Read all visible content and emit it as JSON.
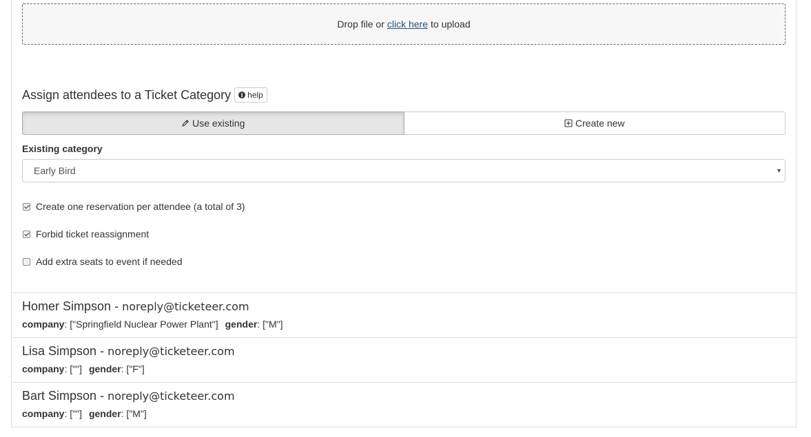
{
  "upload": {
    "prefix": "Drop file or",
    "link": "click here",
    "suffix": "to upload"
  },
  "assign": {
    "title": "Assign attendees to a Ticket Category",
    "help_label": "help",
    "use_existing_label": "Use existing",
    "create_new_label": "Create new",
    "active_tab": "Use existing"
  },
  "category": {
    "label": "Existing category",
    "selected": "Early Bird"
  },
  "options": [
    {
      "label": "Create one reservation per attendee (a total of 3)",
      "checked": true
    },
    {
      "label": "Forbid ticket reassignment",
      "checked": true
    },
    {
      "label": "Add extra seats to event if needed",
      "checked": false
    }
  ],
  "attendees": [
    {
      "name": "Homer Simpson",
      "sep": "-",
      "email": "noreply@ticketeer.com",
      "company_key": "company",
      "company_val": ": [\"Springfield Nuclear Power Plant\"]",
      "gender_key": "gender",
      "gender_val": ": [\"M\"]"
    },
    {
      "name": "Lisa Simpson",
      "sep": "-",
      "email": "noreply@ticketeer.com",
      "company_key": "company",
      "company_val": ": [\"\"]",
      "gender_key": "gender",
      "gender_val": ": [\"F\"]"
    },
    {
      "name": "Bart Simpson",
      "sep": "-",
      "email": "noreply@ticketeer.com",
      "company_key": "company",
      "company_val": ": [\"\"]",
      "gender_key": "gender",
      "gender_val": ": [\"M\"]"
    }
  ],
  "colors": {
    "link": "#23527c",
    "active_button_bg": "#e6e6e6",
    "border": "#dddddd"
  }
}
